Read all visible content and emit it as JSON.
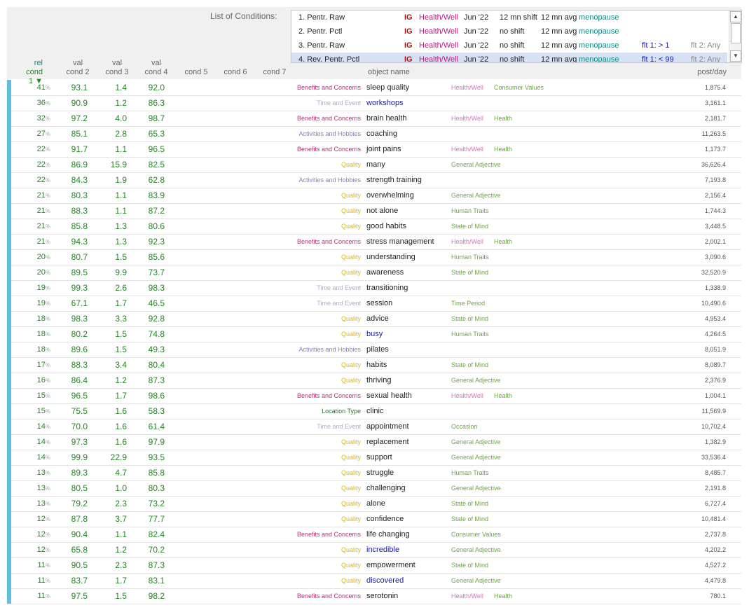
{
  "conditions": {
    "label": "List of Conditions:",
    "items": [
      {
        "num": "1. Pentr. Raw",
        "ig": "IG",
        "cat": "Health/Well",
        "date": "Jun '22",
        "shift": "12 mn shift",
        "avg": "12 mn avg",
        "term": "menopause",
        "f1": "",
        "f2": ""
      },
      {
        "num": "2. Pentr. Pctl",
        "ig": "IG",
        "cat": "Health/Well",
        "date": "Jun '22",
        "shift": "no shift",
        "avg": "12 mn avg",
        "term": "menopause",
        "f1": "",
        "f2": ""
      },
      {
        "num": "3. Pentr. Raw",
        "ig": "IG",
        "cat": "Health/Well",
        "date": "Jun '22",
        "shift": "no shift",
        "avg": "12 mn avg",
        "term": "menopause",
        "f1": "flt 1:  > 1",
        "f2": "flt 2: Any"
      },
      {
        "num": "4. Rev. Pentr. Pctl",
        "ig": "IG",
        "cat": "Health/Well",
        "date": "Jun '22",
        "shift": "no shift",
        "avg": "12 mn avg",
        "term": "menopause",
        "f1": "flt 1:  < 99",
        "f2": "flt 2: Any"
      }
    ]
  },
  "columns": {
    "c1_top": "rel",
    "c1": "cond 1 ▼",
    "c2_top": "val",
    "c2": "cond 2",
    "c3_top": "val",
    "c3": "cond 3",
    "c4_top": "val",
    "c4": "cond 4",
    "c5": "cond 5",
    "c6": "cond 6",
    "c7": "cond 7",
    "object": "object name",
    "post": "post/day"
  },
  "colors": {
    "Benefits and Concerns": "#d21f7a",
    "Time and Event": "#b8a6cc",
    "Activities and Hobbies": "#8b7fb8",
    "Quality": "#d8b814",
    "Location Type": "#1a7a1a",
    "Health/Well": "#e26ac8",
    "Health": "#6aa83a",
    "Consumer Values": "#6aa83a",
    "General Adjective": "#6aa83a",
    "Human Traits": "#6aa83a",
    "State of Mind": "#6aa83a",
    "Time Period": "#6aa83a",
    "Occasion": "#6aa83a",
    "obj_link": "#1a1a9c",
    "obj_plain": "#222222"
  },
  "rows": [
    {
      "rel": "41",
      "v2": "93.1",
      "v3": "1.4",
      "v4": "92.0",
      "cat": "Benefits and Concerns",
      "obj": "sleep quality",
      "link": false,
      "t1": "Health/Well",
      "t2": "Consumer Values",
      "post": "1,875.4"
    },
    {
      "rel": "36",
      "v2": "90.9",
      "v3": "1.2",
      "v4": "86.3",
      "cat": "Time and Event",
      "obj": "workshops",
      "link": true,
      "t1": "",
      "t2": "",
      "post": "3,161.1"
    },
    {
      "rel": "32",
      "v2": "97.2",
      "v3": "4.0",
      "v4": "98.7",
      "cat": "Benefits and Concerns",
      "obj": "brain health",
      "link": false,
      "t1": "Health/Well",
      "t2": "Health",
      "post": "2,181.7"
    },
    {
      "rel": "27",
      "v2": "85.1",
      "v3": "2.8",
      "v4": "65.3",
      "cat": "Activities and Hobbies",
      "obj": "coaching",
      "link": false,
      "t1": "",
      "t2": "",
      "post": "11,263.5"
    },
    {
      "rel": "22",
      "v2": "91.7",
      "v3": "1.1",
      "v4": "96.5",
      "cat": "Benefits and Concerns",
      "obj": "joint pains",
      "link": false,
      "t1": "Health/Well",
      "t2": "Health",
      "post": "1,173.7"
    },
    {
      "rel": "22",
      "v2": "86.9",
      "v3": "15.9",
      "v4": "82.5",
      "cat": "Quality",
      "obj": "many",
      "link": false,
      "t1": "General Adjective",
      "t2": "",
      "post": "36,626.4"
    },
    {
      "rel": "22",
      "v2": "84.3",
      "v3": "1.9",
      "v4": "62.8",
      "cat": "Activities and Hobbies",
      "obj": "strength training",
      "link": false,
      "t1": "",
      "t2": "",
      "post": "7,193.8"
    },
    {
      "rel": "21",
      "v2": "80.3",
      "v3": "1.1",
      "v4": "83.9",
      "cat": "Quality",
      "obj": "overwhelming",
      "link": false,
      "t1": "General Adjective",
      "t2": "",
      "post": "2,156.4"
    },
    {
      "rel": "21",
      "v2": "88.3",
      "v3": "1.1",
      "v4": "87.2",
      "cat": "Quality",
      "obj": "not alone",
      "link": false,
      "t1": "Human Traits",
      "t2": "",
      "post": "1,744.3"
    },
    {
      "rel": "21",
      "v2": "85.8",
      "v3": "1.3",
      "v4": "80.6",
      "cat": "Quality",
      "obj": "good habits",
      "link": false,
      "t1": "State of Mind",
      "t2": "",
      "post": "3,448.5"
    },
    {
      "rel": "21",
      "v2": "94.3",
      "v3": "1.3",
      "v4": "92.3",
      "cat": "Benefits and Concerns",
      "obj": "stress management",
      "link": false,
      "t1": "Health/Well",
      "t2": "Health",
      "post": "2,002.1"
    },
    {
      "rel": "20",
      "v2": "80.7",
      "v3": "1.5",
      "v4": "85.6",
      "cat": "Quality",
      "obj": "understanding",
      "link": false,
      "t1": "Human Traits",
      "t2": "",
      "post": "3,090.6"
    },
    {
      "rel": "20",
      "v2": "89.5",
      "v3": "9.9",
      "v4": "73.7",
      "cat": "Quality",
      "obj": "awareness",
      "link": false,
      "t1": "State of Mind",
      "t2": "",
      "post": "32,520.9"
    },
    {
      "rel": "19",
      "v2": "99.3",
      "v3": "2.6",
      "v4": "98.3",
      "cat": "Time and Event",
      "obj": "transitioning",
      "link": false,
      "t1": "",
      "t2": "",
      "post": "1,338.9"
    },
    {
      "rel": "19",
      "v2": "67.1",
      "v3": "1.7",
      "v4": "46.5",
      "cat": "Time and Event",
      "obj": "session",
      "link": false,
      "t1": "Time Period",
      "t2": "",
      "post": "10,490.6"
    },
    {
      "rel": "18",
      "v2": "98.3",
      "v3": "3.3",
      "v4": "92.8",
      "cat": "Quality",
      "obj": "advice",
      "link": false,
      "t1": "State of Mind",
      "t2": "",
      "post": "4,953.4"
    },
    {
      "rel": "18",
      "v2": "80.2",
      "v3": "1.5",
      "v4": "74.8",
      "cat": "Quality",
      "obj": "busy",
      "link": true,
      "t1": "Human Traits",
      "t2": "",
      "post": "4,264.5"
    },
    {
      "rel": "18",
      "v2": "89.6",
      "v3": "1.5",
      "v4": "49.3",
      "cat": "Activities and Hobbies",
      "obj": "pilates",
      "link": false,
      "t1": "",
      "t2": "",
      "post": "8,051.9"
    },
    {
      "rel": "17",
      "v2": "88.3",
      "v3": "3.4",
      "v4": "80.4",
      "cat": "Quality",
      "obj": "habits",
      "link": false,
      "t1": "State of Mind",
      "t2": "",
      "post": "8,089.7"
    },
    {
      "rel": "16",
      "v2": "86.4",
      "v3": "1.2",
      "v4": "87.3",
      "cat": "Quality",
      "obj": "thriving",
      "link": false,
      "t1": "General Adjective",
      "t2": "",
      "post": "2,376.9"
    },
    {
      "rel": "15",
      "v2": "96.5",
      "v3": "1.7",
      "v4": "98.6",
      "cat": "Benefits and Concerns",
      "obj": "sexual health",
      "link": false,
      "t1": "Health/Well",
      "t2": "Health",
      "post": "1,004.1"
    },
    {
      "rel": "15",
      "v2": "75.5",
      "v3": "1.6",
      "v4": "58.3",
      "cat": "Location Type",
      "obj": "clinic",
      "link": false,
      "t1": "",
      "t2": "",
      "post": "11,569.9"
    },
    {
      "rel": "14",
      "v2": "70.0",
      "v3": "1.6",
      "v4": "61.4",
      "cat": "Time and Event",
      "obj": "appointment",
      "link": false,
      "t1": "Occasion",
      "t2": "",
      "post": "10,702.4"
    },
    {
      "rel": "14",
      "v2": "97.3",
      "v3": "1.6",
      "v4": "97.9",
      "cat": "Quality",
      "obj": "replacement",
      "link": false,
      "t1": "General Adjective",
      "t2": "",
      "post": "1,382.9"
    },
    {
      "rel": "14",
      "v2": "99.9",
      "v3": "22.9",
      "v4": "93.5",
      "cat": "Quality",
      "obj": "support",
      "link": false,
      "t1": "General Adjective",
      "t2": "",
      "post": "33,536.4"
    },
    {
      "rel": "13",
      "v2": "89.3",
      "v3": "4.7",
      "v4": "85.8",
      "cat": "Quality",
      "obj": "struggle",
      "link": false,
      "t1": "Human Traits",
      "t2": "",
      "post": "8,485.7"
    },
    {
      "rel": "13",
      "v2": "80.5",
      "v3": "1.0",
      "v4": "80.3",
      "cat": "Quality",
      "obj": "challenging",
      "link": false,
      "t1": "General Adjective",
      "t2": "",
      "post": "2,191.8"
    },
    {
      "rel": "13",
      "v2": "79.2",
      "v3": "2.3",
      "v4": "73.2",
      "cat": "Quality",
      "obj": "alone",
      "link": false,
      "t1": "State of Mind",
      "t2": "",
      "post": "6,727.4"
    },
    {
      "rel": "12",
      "v2": "87.8",
      "v3": "3.7",
      "v4": "77.7",
      "cat": "Quality",
      "obj": "confidence",
      "link": false,
      "t1": "State of Mind",
      "t2": "",
      "post": "10,481.4"
    },
    {
      "rel": "12",
      "v2": "90.4",
      "v3": "1.1",
      "v4": "82.4",
      "cat": "Benefits and Concerns",
      "obj": "life changing",
      "link": false,
      "t1": "Consumer Values",
      "t2": "",
      "post": "2,737.8"
    },
    {
      "rel": "12",
      "v2": "65.8",
      "v3": "1.2",
      "v4": "70.2",
      "cat": "Quality",
      "obj": "incredible",
      "link": true,
      "t1": "General Adjective",
      "t2": "",
      "post": "4,202.2"
    },
    {
      "rel": "11",
      "v2": "90.5",
      "v3": "2.3",
      "v4": "87.3",
      "cat": "Quality",
      "obj": "empowerment",
      "link": false,
      "t1": "State of Mind",
      "t2": "",
      "post": "4,527.2"
    },
    {
      "rel": "11",
      "v2": "83.7",
      "v3": "1.7",
      "v4": "83.1",
      "cat": "Quality",
      "obj": "discovered",
      "link": true,
      "t1": "General Adjective",
      "t2": "",
      "post": "4,479.8"
    },
    {
      "rel": "11",
      "v2": "97.5",
      "v3": "1.5",
      "v4": "98.2",
      "cat": "Benefits and Concerns",
      "obj": "serotonin",
      "link": false,
      "t1": "Health/Well",
      "t2": "Health",
      "post": "780.1"
    }
  ]
}
